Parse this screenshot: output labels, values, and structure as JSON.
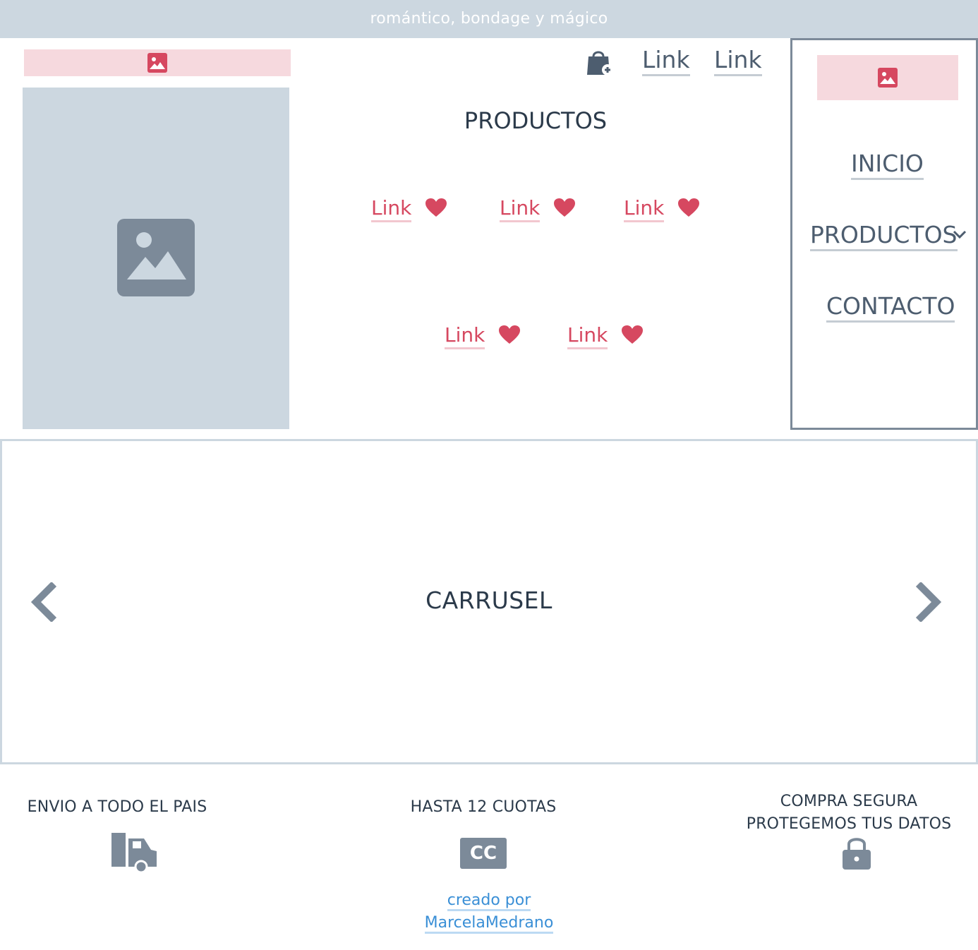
{
  "topbar": {
    "tagline": "romántico, bondage y mágico"
  },
  "header": {
    "links": [
      "Link",
      "Link"
    ],
    "cart_icon": "shopping-bag-add-icon",
    "logo_icon": "image-icon"
  },
  "hero": {
    "image_icon": "image-placeholder-icon"
  },
  "products": {
    "title": "PRODUCTOS",
    "items": [
      {
        "label": "Link",
        "icon": "heart-icon"
      },
      {
        "label": "Link",
        "icon": "heart-icon"
      },
      {
        "label": "Link",
        "icon": "heart-icon"
      },
      {
        "label": "Link",
        "icon": "heart-icon"
      },
      {
        "label": "Link",
        "icon": "heart-icon"
      }
    ]
  },
  "sidebar": {
    "logo_icon": "image-icon",
    "nav": [
      {
        "label": "INICIO"
      },
      {
        "label": "PRODUCTOS",
        "icon": "chevron-down-icon"
      },
      {
        "label": "CONTACTO"
      }
    ]
  },
  "carousel": {
    "title": "CARRUSEL",
    "prev_icon": "chevron-left-icon",
    "next_icon": "chevron-right-icon"
  },
  "features": [
    {
      "text": "ENVIO A TODO EL PAIS",
      "icon": "truck-icon"
    },
    {
      "text": "HASTA 12 CUOTAS",
      "icon": "credit-card-icon",
      "badge": "CC"
    },
    {
      "line1": "COMPRA SEGURA",
      "line2": "PROTEGEMOS TUS DATOS",
      "icon": "lock-icon"
    }
  ],
  "credit": {
    "line1": "creado por",
    "line2": "MarcelaMedrano"
  },
  "colors": {
    "accent": "#d64860",
    "slate": "#7c8a99",
    "light": "#ccd7e0",
    "pink_light": "#f6d9de",
    "link_blue": "#3a8fd6"
  }
}
